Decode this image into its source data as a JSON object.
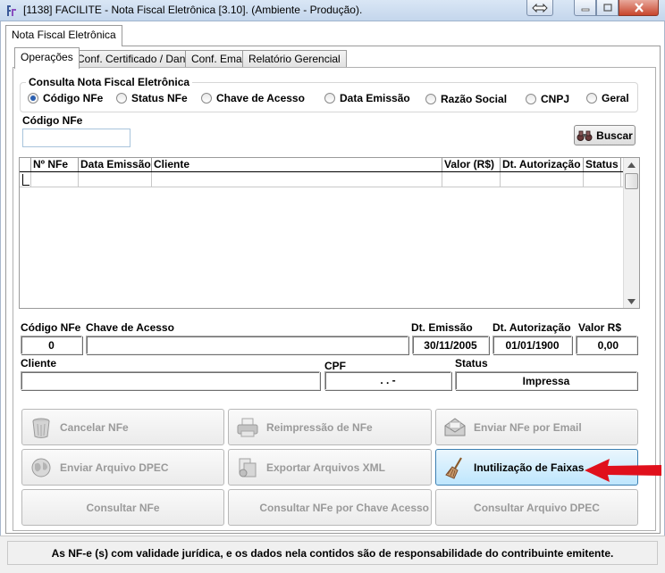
{
  "window": {
    "title": "[1138] FACILITE - Nota Fiscal Eletrônica [3.10]. (Ambiente - Produção)."
  },
  "icons": {
    "app": "app-logo-icon",
    "extra": "arrows-left-right-icon",
    "minimize": "minimize-icon",
    "maximize": "maximize-icon",
    "close": "close-icon"
  },
  "main_tabs": [
    {
      "label": "Nota Fiscal Eletrônica",
      "active": true
    }
  ],
  "sub_tabs": [
    {
      "label": "Operações",
      "active": true
    },
    {
      "label": "Conf. Certificado / Danfe",
      "active": false
    },
    {
      "label": "Conf. Email",
      "active": false
    },
    {
      "label": "Relatório Gerencial",
      "active": false
    }
  ],
  "search": {
    "group_title": "Consulta Nota Fiscal Eletrônica",
    "options": [
      {
        "label": "Código NFe",
        "checked": true
      },
      {
        "label": "Status NFe",
        "checked": false
      },
      {
        "label": "Chave de Acesso",
        "checked": false
      },
      {
        "label": "Data Emissão",
        "checked": false
      },
      {
        "label": "Razão Social",
        "checked": false
      },
      {
        "label": "CNPJ",
        "checked": false
      },
      {
        "label": "Geral",
        "checked": false
      }
    ],
    "field_label": "Código NFe",
    "field_value": "",
    "button_label": "Buscar",
    "button_icon": "binoculars-icon"
  },
  "grid": {
    "columns": [
      "Nº NFe",
      "Data Emissão",
      "Cliente",
      "Valor (R$)",
      "Dt. Autorização",
      "Status"
    ],
    "rows": []
  },
  "details": {
    "codigo_label": "Código NFe",
    "codigo_value": "0",
    "chave_label": "Chave de Acesso",
    "chave_value": "",
    "dt_emissao_label": "Dt. Emissão",
    "dt_emissao_value": "30/11/2005",
    "dt_autorizacao_label": "Dt. Autorização",
    "dt_autorizacao_value": "01/01/1900",
    "valor_label": "Valor R$",
    "valor_value": "0,00",
    "cliente_label": "Cliente",
    "cliente_value": "",
    "cpf_label": "CPF",
    "cpf_value": ". . -",
    "status_label": "Status",
    "status_value": "Impressa"
  },
  "actions": {
    "cancelar": {
      "label": "Cancelar NFe",
      "icon": "trash-can-icon",
      "enabled": false
    },
    "reimpressao": {
      "label": "Reimpressão de NFe",
      "icon": "printer-icon",
      "enabled": false
    },
    "enviar_email": {
      "label": "Enviar NFe por Email",
      "icon": "envelope-icon",
      "enabled": false
    },
    "enviar_dpec": {
      "label": "Enviar Arquivo DPEC",
      "icon": "globe-icon",
      "enabled": false
    },
    "exportar_xml": {
      "label": "Exportar Arquivos XML",
      "icon": "export-files-icon",
      "enabled": false
    },
    "inutilizacao": {
      "label": "Inutilização de Faixas",
      "icon": "broom-icon",
      "enabled": true
    },
    "consultar_nfe": {
      "label": "Consultar NFe",
      "enabled": false
    },
    "consultar_chave": {
      "label": "Consultar NFe por Chave Acesso",
      "enabled": false
    },
    "consultar_dpec": {
      "label": "Consultar Arquivo DPEC",
      "enabled": false
    }
  },
  "annotation": {
    "arrow_color": "#e0101c",
    "arrow_icon": "red-arrow-icon"
  },
  "footer": {
    "text": "As NF-e (s) com validade jurídica, e os dados nela contidos são de responsabilidade do contribuinte emitente."
  }
}
